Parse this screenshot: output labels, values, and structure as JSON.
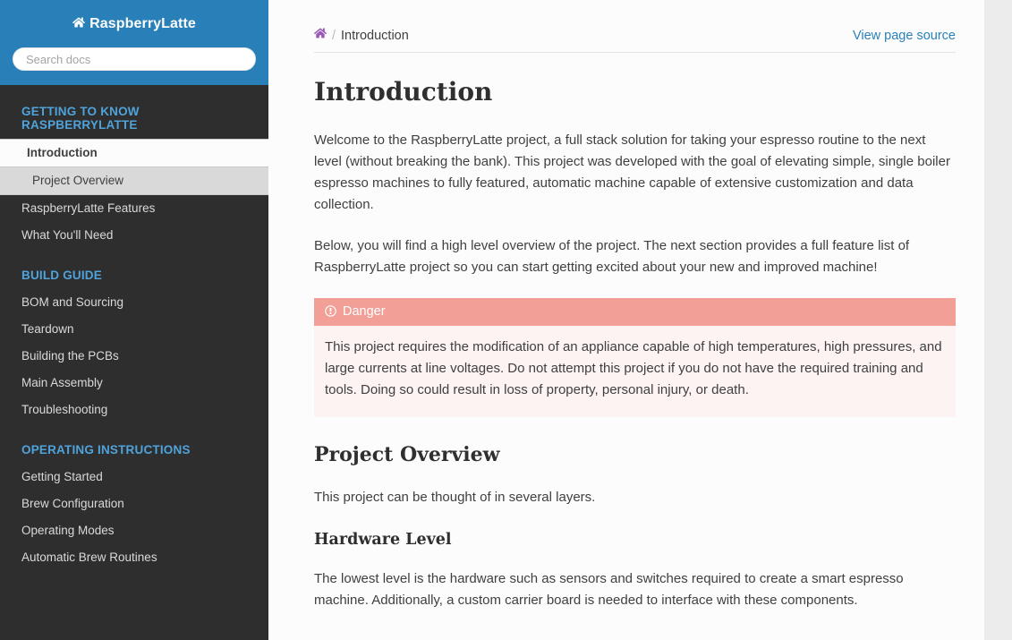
{
  "sidebar": {
    "brand": {
      "label": "RaspberryLatte",
      "icon": "home-icon"
    },
    "search": {
      "placeholder": "Search docs",
      "value": "",
      "icon": "search-input"
    },
    "sections": [
      {
        "caption": "GETTING TO KNOW RASPBERRYLATTE",
        "items": [
          {
            "label": "Introduction",
            "current": true,
            "children": [
              {
                "label": "Project Overview"
              }
            ]
          },
          {
            "label": "RaspberryLatte Features",
            "current": false,
            "children": []
          },
          {
            "label": "What You'll Need",
            "current": false,
            "children": []
          }
        ]
      },
      {
        "caption": "BUILD GUIDE",
        "items": [
          {
            "label": "BOM and Sourcing",
            "current": false,
            "children": []
          },
          {
            "label": "Teardown",
            "current": false,
            "children": []
          },
          {
            "label": "Building the PCBs",
            "current": false,
            "children": []
          },
          {
            "label": "Main Assembly",
            "current": false,
            "children": []
          },
          {
            "label": "Troubleshooting",
            "current": false,
            "children": []
          }
        ]
      },
      {
        "caption": "OPERATING INSTRUCTIONS",
        "items": [
          {
            "label": "Getting Started",
            "current": false,
            "children": []
          },
          {
            "label": "Brew Configuration",
            "current": false,
            "children": []
          },
          {
            "label": "Operating Modes",
            "current": false,
            "children": []
          },
          {
            "label": "Automatic Brew Routines",
            "current": false,
            "children": []
          }
        ]
      }
    ]
  },
  "breadcrumb": {
    "home_icon": "home-icon",
    "separator": "/",
    "current": "Introduction",
    "page_source_label": "View page source"
  },
  "main": {
    "title": "Introduction",
    "paragraphs": [
      "Welcome to the RaspberryLatte project, a full stack solution for taking your espresso routine to the next level (without breaking the bank). This project was developed with the goal of elevating simple, single boiler espresso machines to fully featured, automatic machine capable of extensive customization and data collection.",
      "Below, you will find a high level overview of the project. The next section provides a full feature list of RaspberryLatte project so you can start getting excited about your new and improved machine!"
    ],
    "admonition": {
      "type": "danger",
      "icon": "exclamation-circle-icon",
      "title": "Danger",
      "body": "This project requires the modification of an appliance capable of high temperatures, high pressures, and large currents at line voltages. Do not attempt this project if you do not have the required training and tools. Doing so could result in loss of property, personal injury, or death."
    },
    "section_overview": {
      "heading": "Project Overview",
      "paragraph": "This project can be thought of in several layers."
    },
    "section_hardware": {
      "heading": "Hardware Level",
      "paragraph": "The lowest level is the hardware such as sensors and switches required to create a smart espresso machine. Additionally, a custom carrier board is needed to interface with these components."
    }
  },
  "colors": {
    "sidebar_header": "#2980b9",
    "sidebar_bg": "#2e2e2e",
    "caption": "#4fa3db",
    "link": "#2980b9",
    "visited_link": "#9B59B6",
    "danger_title_bg": "#f29f97",
    "danger_body_bg": "#fdf3f2",
    "text": "#404040"
  }
}
